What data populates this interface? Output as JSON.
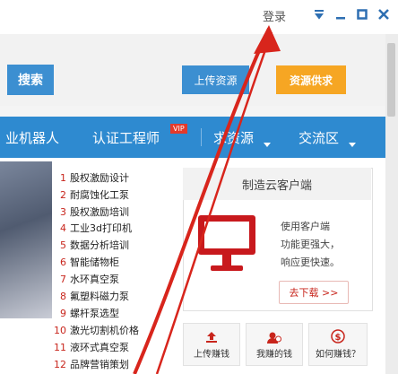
{
  "window": {
    "login_label": "登录"
  },
  "header": {
    "search_label": "搜索",
    "upload_label": "上传资源",
    "supply_label": "资源供求"
  },
  "nav": {
    "items": [
      {
        "label": "业机器人"
      },
      {
        "label": "认证工程师"
      },
      {
        "label": "求资源"
      },
      {
        "label": "交流区"
      }
    ],
    "vip_badge": "VIP"
  },
  "hot_list": [
    {
      "num": "1",
      "text": "股权激励设计"
    },
    {
      "num": "2",
      "text": "耐腐蚀化工泵"
    },
    {
      "num": "3",
      "text": "股权激励培训"
    },
    {
      "num": "4",
      "text": "工业3d打印机"
    },
    {
      "num": "5",
      "text": "数据分析培训"
    },
    {
      "num": "6",
      "text": "智能储物柜"
    },
    {
      "num": "7",
      "text": "水环真空泵"
    },
    {
      "num": "8",
      "text": "氟塑料磁力泵"
    },
    {
      "num": "9",
      "text": "螺杆泵选型"
    },
    {
      "num": "10",
      "text": "激光切割机价格"
    },
    {
      "num": "11",
      "text": "液环式真空泵"
    },
    {
      "num": "12",
      "text": "品牌营销策划"
    }
  ],
  "client_card": {
    "title": "制造云客户端",
    "lines": [
      "使用客户端",
      "功能更强大，",
      "响应更快速。"
    ],
    "download_label": "去下载 >>"
  },
  "bottom_actions": [
    {
      "label": "上传赚钱",
      "icon": "upload-icon"
    },
    {
      "label": "我赚的钱",
      "icon": "earnings-icon"
    },
    {
      "label": "如何赚钱？",
      "icon": "dollar-icon"
    }
  ],
  "colors": {
    "accent_blue": "#2e8ad0",
    "accent_orange": "#f6a623",
    "annotation_red": "#d8251c",
    "monitor_red": "#c8191d"
  }
}
